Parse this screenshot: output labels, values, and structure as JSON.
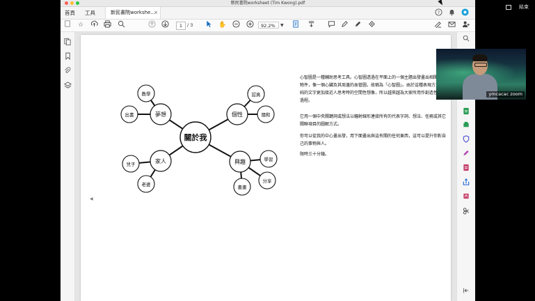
{
  "window": {
    "title": "新民書院worksheet (Tim Kwong).pdf"
  },
  "tabs": {
    "home": "首頁",
    "tools": "工具",
    "doc": "新民書院workshe...",
    "close": "×"
  },
  "toolbar": {
    "page_current": "1",
    "page_total": "/ 3",
    "zoom": "92.2%"
  },
  "mindmap": {
    "center": "關於我",
    "branches": [
      {
        "label": "夢想",
        "children": [
          "教學",
          "出書"
        ]
      },
      {
        "label": "個性",
        "children": [
          "認真",
          "隨和"
        ]
      },
      {
        "label": "家人",
        "children": [
          "兒子",
          "老婆"
        ]
      },
      {
        "label": "興趣",
        "children": [
          "學習",
          "分享",
          "畫畫"
        ]
      }
    ]
  },
  "document": {
    "paragraphs": [
      "心智圖是一種輔助思考工具。心智圖透過在平面上的一個主題出發畫出相關聯的物件，像一個心臟及其周邊的血管圖，故稱為「心智圖」。由於這種表現方式比單純的文字更加接近人思考時的空間性想像，所以越來越為大家所用作創造性思維過程。",
      "它用一個中央關鍵詞或想法以輻射線形連接所有的代表字詞、想法、任務或其它關聯項目的圖解方式。",
      "你可以從我的中心畫出發，用下面畫出與這有關的任何東西，這可以提升你對自己的事物與人。",
      "限時三十分鐘。"
    ]
  },
  "overlay": {
    "external_label": "結束",
    "video_name": "ymcacac zoom"
  }
}
